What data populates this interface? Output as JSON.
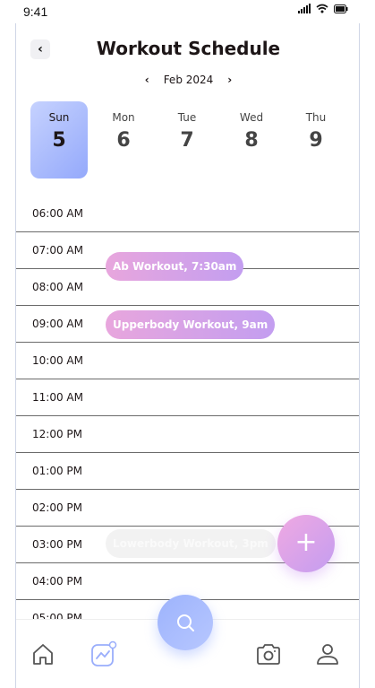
{
  "status_bar": {
    "time": "9:41"
  },
  "header": {
    "title": "Workout Schedule",
    "back_icon": "chevron-left-icon"
  },
  "month_nav": {
    "label": "Feb 2024"
  },
  "days": [
    {
      "name": "Sun",
      "num": "5",
      "active": true
    },
    {
      "name": "Mon",
      "num": "6",
      "active": false
    },
    {
      "name": "Tue",
      "num": "7",
      "active": false
    },
    {
      "name": "Wed",
      "num": "8",
      "active": false
    },
    {
      "name": "Thu",
      "num": "9",
      "active": false
    }
  ],
  "timeline": {
    "slots": [
      "06:00 AM",
      "07:00 AM",
      "08:00 AM",
      "09:00 AM",
      "10:00 AM",
      "11:00 AM",
      "12:00 PM",
      "01:00 PM",
      "02:00 PM",
      "03:00 PM",
      "04:00 PM",
      "05:00 PM"
    ],
    "events": [
      {
        "label": "Ab Workout, 7:30am"
      },
      {
        "label": "Upperbody Workout, 9am"
      },
      {
        "label": "Lowerbody Workout, 3pm"
      }
    ]
  },
  "fab": {
    "label": "+"
  },
  "nav": {
    "items": [
      "home-icon",
      "activity-icon",
      "search-icon",
      "camera-icon",
      "profile-icon"
    ]
  },
  "colors": {
    "accent_blue": "#94a9fb",
    "accent_pink": "#e8a6dd",
    "accent_purple": "#c39ef0"
  }
}
